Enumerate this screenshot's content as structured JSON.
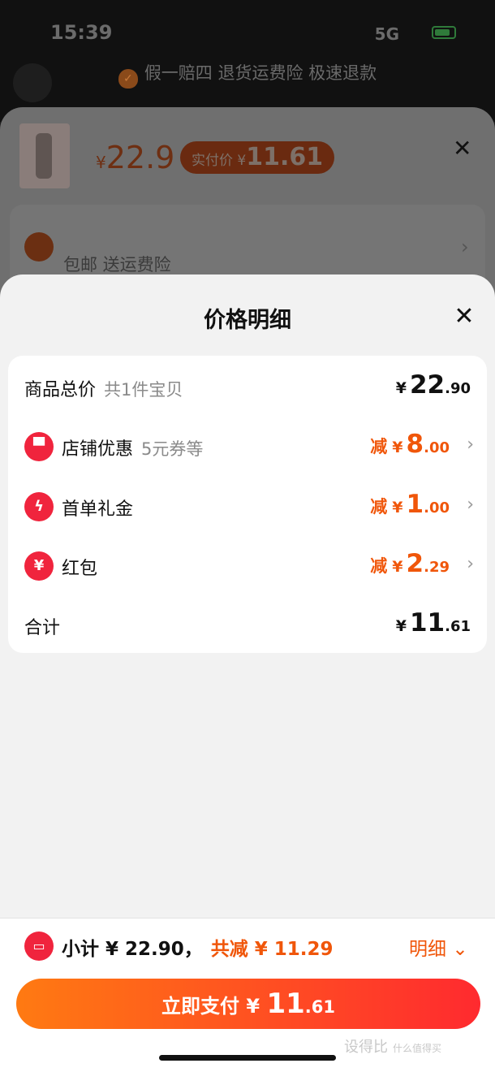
{
  "status_bar": {
    "time": "15:39",
    "network": "5G"
  },
  "top_banner": {
    "text": "假一赔四 退货运费险 极速退款"
  },
  "back_sheet": {
    "price_symbol": "¥",
    "price": "22.9",
    "actual_pay_label": "实付价 ¥",
    "actual_pay_value": "11.61",
    "close_glyph": "✕",
    "shipping_text": "包邮  送运费险",
    "chevron": "›"
  },
  "price_detail": {
    "title": "价格明细",
    "close_glyph": "✕",
    "rows": [
      {
        "label": "商品总价",
        "sub": "共1件宝贝",
        "yen": "¥",
        "integer": "22",
        "decimal": ".90"
      },
      {
        "icon": "store-icon",
        "icon_glyph": "▀",
        "label": "店铺优惠",
        "sub": "5元券等",
        "prefix": "减",
        "yen": "¥",
        "integer": "8",
        "decimal": ".00"
      },
      {
        "icon": "lightning-icon",
        "icon_glyph": "ϟ",
        "label": "首单礼金",
        "prefix": "减",
        "yen": "¥",
        "integer": "1",
        "decimal": ".00"
      },
      {
        "icon": "red-packet-icon",
        "icon_glyph": "¥",
        "label": "红包",
        "prefix": "减",
        "yen": "¥",
        "integer": "2",
        "decimal": ".29"
      },
      {
        "label": "合计",
        "yen": "¥",
        "integer": "11",
        "decimal": ".61"
      }
    ],
    "chevron": "›"
  },
  "bottom_bar": {
    "ticket_glyph": "▭",
    "subtotal_text": "小计 ¥ 22.90，",
    "saving_text": "共减 ¥ 11.29",
    "detail_link": "明细",
    "detail_chevron": "⌄",
    "pay_label": "立即支付 ¥",
    "pay_integer": "11",
    "pay_decimal": ".61"
  },
  "watermark": {
    "text": "设得比",
    "sub": "什么值得买"
  },
  "colors": {
    "accent": "#f0560a",
    "brand_red": "#f0243d",
    "pay_gradient_start": "#ff7a12",
    "pay_gradient_end": "#ff2a2f"
  }
}
